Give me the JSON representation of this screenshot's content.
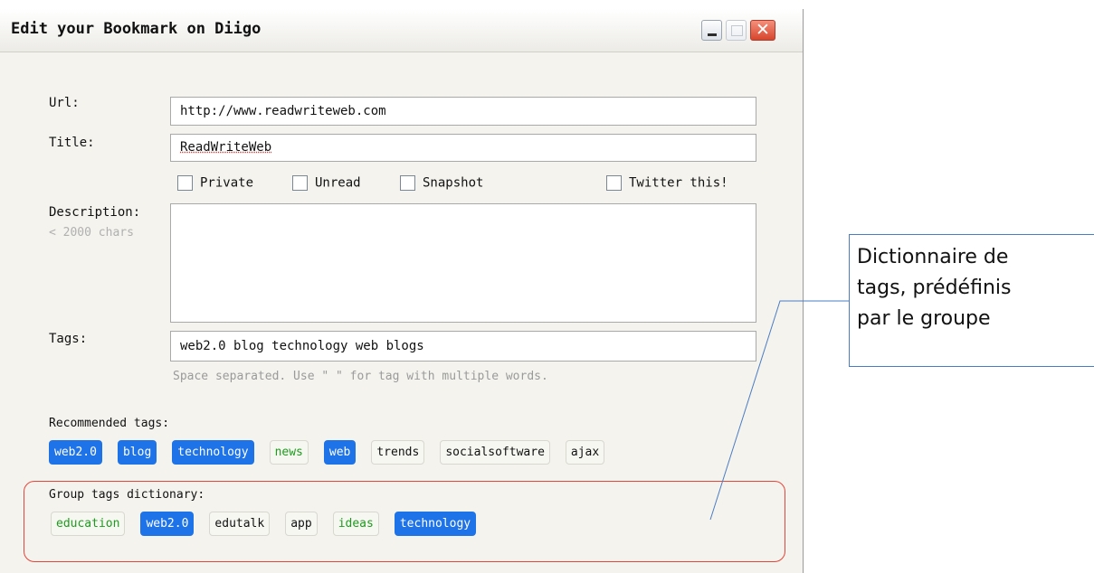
{
  "window": {
    "title": "Edit your Bookmark on Diigo",
    "close_glyph": "✕"
  },
  "form": {
    "url_label": "Url:",
    "url_value": "http://www.readwriteweb.com",
    "title_label": "Title:",
    "title_value": "ReadWriteWeb",
    "checkboxes": {
      "private": "Private",
      "unread": "Unread",
      "snapshot": "Snapshot",
      "twitter": "Twitter this!"
    },
    "description_label": "Description:",
    "description_hint": "< 2000 chars",
    "description_value": "",
    "tags_label": "Tags:",
    "tags_value": "web2.0 blog technology web blogs",
    "tags_hint": "Space separated. Use \" \" for tag with multiple words."
  },
  "recommended": {
    "label": "Recommended tags:",
    "tags": [
      {
        "text": "web2.0",
        "style": "selected"
      },
      {
        "text": "blog",
        "style": "selected"
      },
      {
        "text": "technology",
        "style": "selected"
      },
      {
        "text": "news",
        "style": "green"
      },
      {
        "text": "web",
        "style": "selected"
      },
      {
        "text": "trends",
        "style": "plain"
      },
      {
        "text": "socialsoftware",
        "style": "plain"
      },
      {
        "text": "ajax",
        "style": "plain"
      }
    ]
  },
  "group": {
    "label": "Group tags dictionary:",
    "tags": [
      {
        "text": "education",
        "style": "green"
      },
      {
        "text": "web2.0",
        "style": "selected"
      },
      {
        "text": "edutalk",
        "style": "plain"
      },
      {
        "text": "app",
        "style": "plain"
      },
      {
        "text": "ideas",
        "style": "green"
      },
      {
        "text": "technology",
        "style": "selected"
      }
    ]
  },
  "annotation": {
    "line1": "Dictionnaire de",
    "line2": "tags, prédéfinis",
    "line3": "par le groupe"
  },
  "colors": {
    "selected_tag": "#1e73e8",
    "green_tag": "#1e9b1e",
    "highlight_box": "#e0463a",
    "callout": "#4a7cc4"
  }
}
